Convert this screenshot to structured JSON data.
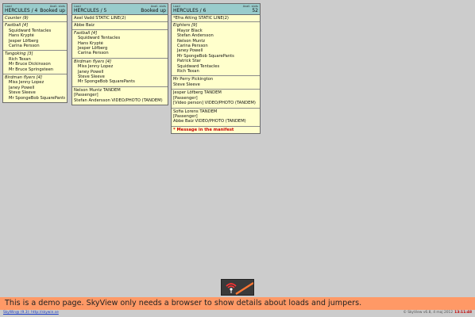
{
  "loads": [
    {
      "labels": {
        "load": "Load",
        "avail": "Avail. slots"
      },
      "plane": "HERCULES / 4",
      "avail": "Booked up",
      "counter": "Counter (9)",
      "groups": [
        {
          "title": "Fastball [4]",
          "members": [
            "Squidward Tentacles",
            "Hans Krypté",
            "Jesper Löfberg",
            "Carina Persson"
          ]
        },
        {
          "title": "Tangoking [3]",
          "members": [
            "Rich Texan",
            "Mr Bruce Dickinsson",
            "Mr Bruce Springsteen"
          ]
        },
        {
          "title": "Birdman flyers [4]",
          "members": [
            "Miss Jenny Lopez",
            "Janey Powell",
            "Steve Sleeve",
            "Mr SpongeBob SquarePants"
          ]
        }
      ]
    },
    {
      "labels": {
        "load": "Load",
        "avail": "Avail. slots"
      },
      "plane": "HERCULES / 5",
      "avail": "Booked up",
      "single1": "Axel Vadd STATIC LINE(2)",
      "single2": "Abbe Baiz",
      "groups": [
        {
          "title": "Fastball [4]",
          "members": [
            "Squidward Tentacles",
            "Hans Krypté",
            "Jesper Löfberg",
            "Carina Persson"
          ]
        },
        {
          "title": "Birdman flyers [4]",
          "members": [
            "Miss Jenny Lopez",
            "Janey Powell",
            "Steve Sleeve",
            "Mr SpongeBob SquarePants"
          ]
        }
      ],
      "tandem": [
        "Nelson Muntz TANDEM",
        "[Passenger]",
        "Stefan Andersson VIDEO/PHOTO (TANDEM)"
      ]
    },
    {
      "labels": {
        "load": "Load",
        "avail": "Avail. slots"
      },
      "plane": "HERCULES / 6",
      "avail": "52",
      "single1": "*Efra Atting STATIC LINE(2)",
      "groups": [
        {
          "title": "Eighters [9]",
          "members": [
            "Mayor Black",
            "Stefan Andersson",
            "Nelson Muntz",
            "Carina Persson",
            "Janey Powell",
            "Mr SpongeBob SquarePants",
            "Patrick Star",
            "Squidward Tentacles",
            "Rich Texan"
          ]
        }
      ],
      "pair": [
        "Mr Perry Pickington",
        "Steve Sleeve"
      ],
      "tandem1": [
        "Jesper Löfberg TANDEM",
        "[Passenger]",
        "[Video person] VIDEO/PHOTO (TANDEM)"
      ],
      "tandem2": [
        "Sofia Lorens TANDEM",
        "[Passenger]",
        "Abbe Baiz VIDEO/PHOTO (TANDEM)"
      ],
      "note": "* Message in the manifest"
    }
  ],
  "logo_icon": "skyview-logo-icon",
  "footer": {
    "demo_text": "This is a demo page. SkyView only needs a browser to show details about loads and jumpers.",
    "link": "SkyWin@ (9.3): http://skywin.se",
    "copyright": "© SkyView v6.8, 4 maj 2012",
    "clock": "13:11:48"
  },
  "colors": {
    "card_bg": "#ffffcc",
    "header_bg": "#99cccc",
    "footer_bg": "#ff9966",
    "note": "#cc0000"
  }
}
